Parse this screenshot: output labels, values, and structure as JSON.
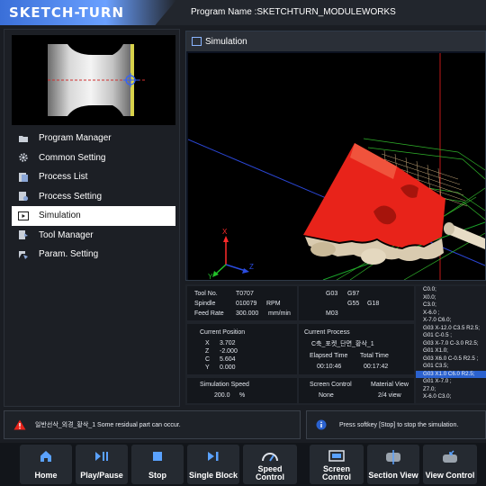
{
  "header": {
    "logo": "SKETCH-TURN",
    "program_name": "Program Name :SKETCHTURN_MODULEWORKS"
  },
  "sidebar": {
    "items": [
      {
        "label": "Program Manager",
        "icon": "folder-icon"
      },
      {
        "label": "Common Setting",
        "icon": "gear-icon"
      },
      {
        "label": "Process List",
        "icon": "list-icon"
      },
      {
        "label": "Process Setting",
        "icon": "process-setting-icon"
      },
      {
        "label": "Simulation",
        "icon": "simulation-icon",
        "active": true
      },
      {
        "label": "Tool Manager",
        "icon": "tool-icon"
      },
      {
        "label": "Param. Setting",
        "icon": "param-icon"
      }
    ]
  },
  "simulation": {
    "title": "Simulation",
    "axes": {
      "x": "X",
      "y": "Y",
      "z": "Z"
    }
  },
  "info": {
    "tool_no_label": "Tool No.",
    "tool_no": "T0707",
    "spindle_label": "Spindle",
    "spindle": "010079",
    "spindle_unit": "RPM",
    "feed_label": "Feed Rate",
    "feed": "300.000",
    "feed_unit": "mm/min",
    "modal": {
      "g1": "G03",
      "g2": "G97",
      "g3": "G55",
      "g4": "G18",
      "m": "M03"
    },
    "current_position_label": "Current Position",
    "positions": [
      {
        "axis": "X",
        "value": "3.702"
      },
      {
        "axis": "Z",
        "value": "-2.000"
      },
      {
        "axis": "C",
        "value": "5.604"
      },
      {
        "axis": "Y",
        "value": "0.000"
      }
    ],
    "current_process_label": "Current Process",
    "current_process": "C축_포켓_단면_황삭_1",
    "elapsed_time_label": "Elapsed Time",
    "elapsed_time": "00:10:46",
    "total_time_label": "Total Time",
    "total_time": "00:17:42",
    "sim_speed_label": "Simulation Speed",
    "sim_speed": "200.0",
    "sim_speed_unit": "%",
    "screen_control_label": "Screen Control",
    "screen_control": "None",
    "material_view_label": "Material View",
    "material_view": "2/4 view"
  },
  "gcode": {
    "lines": [
      "C0.0;",
      "X0.0;",
      "C3.0;",
      "X-6.0 ;",
      "X-7.0 C6.0;",
      "G03 X-12.0 C3.5 R2.5;",
      "G01 C-0.5 ;",
      "G03 X-7.0 C-3.0 R2.5;",
      "G01 X1.0;",
      "G03 X6.0 C-0.5 R2.5 ;",
      "G01 C3.5;",
      "G03 X1.0 C6.0 R2.5;",
      "G01 X-7.0 ;",
      "Z7.0;",
      "X-6.0 C3.0;"
    ],
    "highlight_index": 11
  },
  "status": {
    "warning": "일반선삭_외경_황삭_1  Some residual part can occur.",
    "info": "Press softkey [Stop] to stop the simulation."
  },
  "softkeys": [
    {
      "label": "Home",
      "icon": "home-icon"
    },
    {
      "label": "Play/Pause",
      "icon": "play-pause-icon"
    },
    {
      "label": "Stop",
      "icon": "stop-icon"
    },
    {
      "label": "Single Block",
      "icon": "single-block-icon"
    },
    {
      "label": "Speed Control",
      "icon": "speed-icon"
    },
    {
      "label": "Screen Control",
      "icon": "screen-icon"
    },
    {
      "label": "Section View",
      "icon": "section-view-icon"
    },
    {
      "label": "View Control",
      "icon": "view-control-icon"
    }
  ],
  "colors": {
    "accent": "#3a6fd8",
    "part": "#e8231a",
    "highlight": "#2b62cf"
  }
}
